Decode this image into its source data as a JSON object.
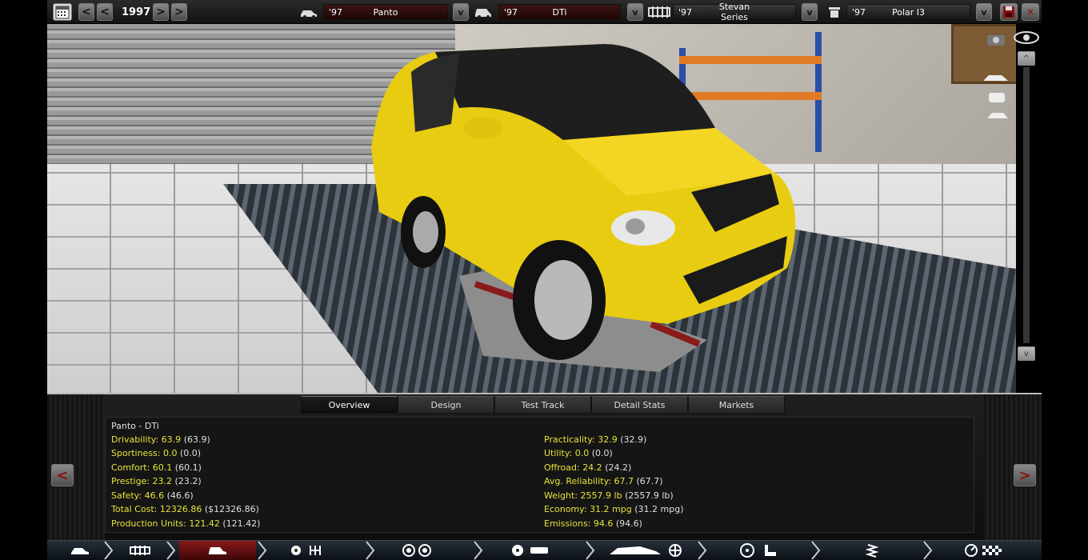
{
  "topbar": {
    "calendar_icon": "calendar-icon",
    "prev_fast_label": "<<",
    "prev_label": "<",
    "year": "1997",
    "next_label": ">",
    "next_fast_label": ">>",
    "selectors": [
      {
        "icon": "car-family-icon",
        "year": "'97",
        "name": "Panto"
      },
      {
        "icon": "car-model-icon",
        "year": "'97",
        "name": "DTi"
      },
      {
        "icon": "chassis-icon",
        "year": "'97",
        "name": "Stevan Series"
      },
      {
        "icon": "engine-icon",
        "year": "'97",
        "name": "Polar I3"
      }
    ],
    "dropdown_label": "v",
    "save_icon": "save-icon",
    "close_label": "✕"
  },
  "scene_tools": {
    "camera_icon": "camera-icon",
    "eye_icon": "eye-icon",
    "scroll_up_label": "^",
    "scroll_down_label": "v"
  },
  "panel": {
    "tabs": [
      "Overview",
      "Design",
      "Test Track",
      "Detail Stats",
      "Markets"
    ],
    "active_tab": "Overview",
    "title": "Panto - DTi",
    "left_stats": [
      {
        "label": "Drivability:",
        "value": "63.9",
        "paren": "(63.9)"
      },
      {
        "label": "Sportiness:",
        "value": "0.0",
        "paren": "(0.0)"
      },
      {
        "label": "Comfort:",
        "value": "60.1",
        "paren": "(60.1)"
      },
      {
        "label": "Prestige:",
        "value": "23.2",
        "paren": "(23.2)"
      },
      {
        "label": "Safety:",
        "value": "46.6",
        "paren": "(46.6)"
      },
      {
        "label": "Total Cost:",
        "value": "12326.86",
        "paren": "($12326.86)"
      },
      {
        "label": "Production Units:",
        "value": "121.42",
        "paren": "(121.42)"
      }
    ],
    "right_stats": [
      {
        "label": "Practicality:",
        "value": "32.9",
        "paren": "(32.9)"
      },
      {
        "label": "Utility:",
        "value": "0.0",
        "paren": "(0.0)"
      },
      {
        "label": "Offroad:",
        "value": "24.2",
        "paren": "(24.2)"
      },
      {
        "label": "Avg. Reliability:",
        "value": "67.7",
        "paren": "(67.7)"
      },
      {
        "label": "Weight:",
        "value": "2557.9 lb",
        "paren": "(2557.9 lb)"
      },
      {
        "label": "Economy:",
        "value": "31.2 mpg",
        "paren": "(31.2 mpg)"
      },
      {
        "label": "Emissions:",
        "value": "94.6",
        "paren": "(94.6)"
      }
    ],
    "prev_label": "<",
    "next_label": ">"
  },
  "bottomnav": {
    "items": [
      "car-family-icon",
      "chassis-icon",
      "car-model-icon",
      "engine-gearbox-icon",
      "wheels-icon",
      "brakes-icon",
      "body-fans-icon",
      "steering-seat-icon",
      "suspension-icon",
      "testing-icon"
    ],
    "active_index": 2
  },
  "colors": {
    "stat_highlight": "#e7e33a",
    "selector_bg": "#3c1414",
    "active_nav": "#8b1a1a"
  }
}
